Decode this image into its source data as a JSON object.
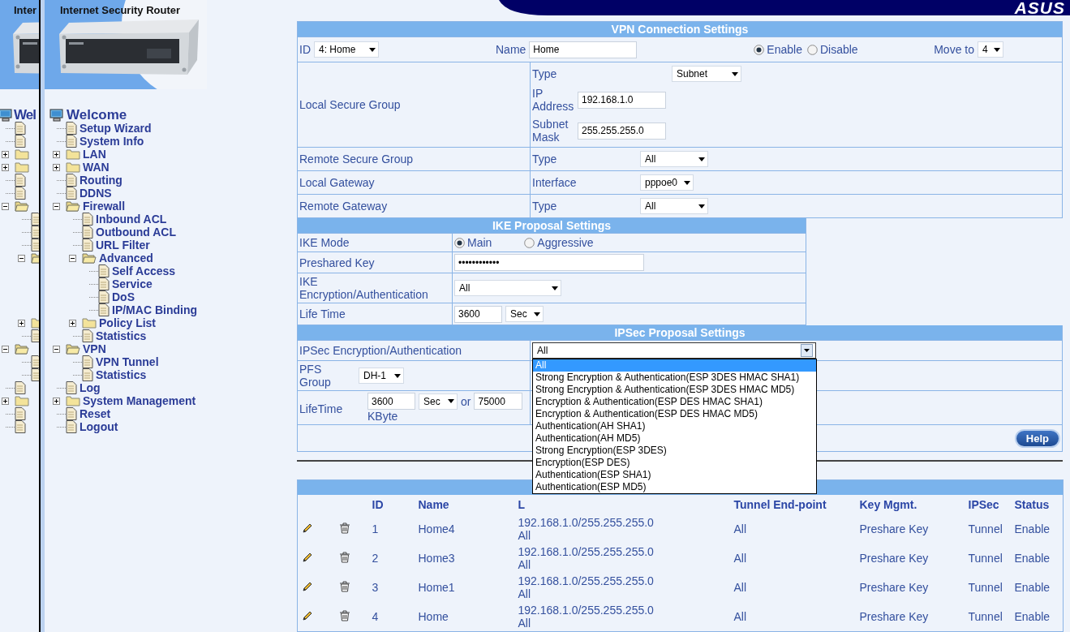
{
  "header": {
    "logo": "ASUS"
  },
  "ghost_sidebar": {
    "banner_title": "Inter",
    "root_label": "Wel"
  },
  "sidebar": {
    "banner_title": "Internet Security Router",
    "tree": [
      {
        "kind": "computer",
        "label": "Welcome",
        "children": [
          {
            "kind": "page",
            "label": "Setup Wizard"
          },
          {
            "kind": "page",
            "label": "System Info"
          },
          {
            "kind": "folder",
            "label": "LAN",
            "expanded": false
          },
          {
            "kind": "folder",
            "label": "WAN",
            "expanded": false
          },
          {
            "kind": "page",
            "label": "Routing"
          },
          {
            "kind": "page",
            "label": "DDNS"
          },
          {
            "kind": "folder",
            "label": "Firewall",
            "expanded": true,
            "children": [
              {
                "kind": "page",
                "label": "Inbound ACL"
              },
              {
                "kind": "page",
                "label": "Outbound ACL"
              },
              {
                "kind": "page",
                "label": "URL Filter"
              },
              {
                "kind": "folder",
                "label": "Advanced",
                "expanded": true,
                "children": [
                  {
                    "kind": "page",
                    "label": "Self Access"
                  },
                  {
                    "kind": "page",
                    "label": "Service"
                  },
                  {
                    "kind": "page",
                    "label": "DoS"
                  },
                  {
                    "kind": "page",
                    "label": "IP/MAC Binding"
                  }
                ]
              },
              {
                "kind": "folder",
                "label": "Policy List",
                "expanded": false
              },
              {
                "kind": "page",
                "label": "Statistics"
              }
            ]
          },
          {
            "kind": "folder",
            "label": "VPN",
            "expanded": true,
            "children": [
              {
                "kind": "page",
                "label": "VPN Tunnel"
              },
              {
                "kind": "page",
                "label": "Statistics"
              }
            ]
          },
          {
            "kind": "page",
            "label": "Log"
          },
          {
            "kind": "folder",
            "label": "System Management",
            "expanded": false
          },
          {
            "kind": "page",
            "label": "Reset"
          },
          {
            "kind": "page",
            "label": "Logout"
          }
        ]
      }
    ]
  },
  "vpn_connection": {
    "title": "VPN Connection Settings",
    "id": {
      "label": "ID",
      "value": "4: Home"
    },
    "name": {
      "label": "Name",
      "value": "Home"
    },
    "status": [
      {
        "label": "Enable",
        "selected": true
      },
      {
        "label": "Disable",
        "selected": false
      }
    ],
    "move_to": {
      "label": "Move to",
      "value": "4"
    },
    "rows": [
      {
        "label": "Local Secure Group",
        "fields": [
          {
            "label": "Type",
            "kind": "select",
            "value": "Subnet"
          },
          {
            "label": "IP Address",
            "kind": "input",
            "value": "192.168.1.0"
          },
          {
            "label": "Subnet Mask",
            "kind": "input",
            "value": "255.255.255.0"
          }
        ]
      },
      {
        "label": "Remote Secure Group",
        "fields": [
          {
            "label": "Type",
            "kind": "select",
            "value": "All"
          }
        ]
      },
      {
        "label": "Local Gateway",
        "fields": [
          {
            "label": "Interface",
            "kind": "select",
            "value": "pppoe0"
          }
        ]
      },
      {
        "label": "Remote Gateway",
        "fields": [
          {
            "label": "Type",
            "kind": "select",
            "value": "All"
          }
        ]
      }
    ]
  },
  "ike_proposal": {
    "title": "IKE Proposal Settings",
    "mode": {
      "label": "IKE Mode",
      "options": [
        {
          "label": "Main",
          "selected": true
        },
        {
          "label": "Aggressive",
          "selected": false
        }
      ]
    },
    "preshared_key": {
      "label": "Preshared Key",
      "value": "••••••••••••"
    },
    "encryption": {
      "label": "IKE Encryption/Authentication",
      "value": "All"
    },
    "life_time": {
      "label": "Life Time",
      "value": "3600",
      "unit": "Sec"
    }
  },
  "ipsec_proposal": {
    "title": "IPSec Proposal Settings",
    "encryption": {
      "label": "IPSec Encryption/Authentication",
      "value": "All",
      "expanded": true,
      "options": [
        {
          "label": "All",
          "selected": true
        },
        {
          "label": "Strong Encryption & Authentication(ESP 3DES HMAC SHA1)",
          "selected": false
        },
        {
          "label": "Strong Encryption & Authentication(ESP 3DES HMAC MD5)",
          "selected": false
        },
        {
          "label": "Encryption & Authentication(ESP DES HMAC SHA1)",
          "selected": false
        },
        {
          "label": "Encryption & Authentication(ESP DES HMAC MD5)",
          "selected": false
        },
        {
          "label": "Authentication(AH SHA1)",
          "selected": false
        },
        {
          "label": "Authentication(AH MD5)",
          "selected": false
        },
        {
          "label": "Strong Encryption(ESP 3DES)",
          "selected": false
        },
        {
          "label": "Encryption(ESP DES)",
          "selected": false
        },
        {
          "label": "Authentication(ESP SHA1)",
          "selected": false
        },
        {
          "label": "Authentication(ESP MD5)",
          "selected": false
        }
      ]
    },
    "pfs": {
      "label": "PFS Group",
      "value": "DH-1"
    },
    "lifetime": {
      "label": "LifeTime",
      "time": "3600",
      "unit": "Sec",
      "or": "or",
      "kbytes": "75000",
      "kbyte_label": "KByte"
    },
    "help": "Help"
  },
  "tunnels": {
    "columns": [
      "ID",
      "Name",
      "L",
      "Tunnel End-point",
      "Key Mgmt.",
      "IPSec",
      "Status"
    ],
    "rows": [
      {
        "id": "1",
        "name": "Home4",
        "local": "192.168.1.0/255.255.255.0",
        "remote": "All",
        "endpoint": "All",
        "key": "Preshare Key",
        "ipsec": "Tunnel",
        "status": "Enable"
      },
      {
        "id": "2",
        "name": "Home3",
        "local": "192.168.1.0/255.255.255.0",
        "remote": "All",
        "endpoint": "All",
        "key": "Preshare Key",
        "ipsec": "Tunnel",
        "status": "Enable"
      },
      {
        "id": "3",
        "name": "Home1",
        "local": "192.168.1.0/255.255.255.0",
        "remote": "All",
        "endpoint": "All",
        "key": "Preshare Key",
        "ipsec": "Tunnel",
        "status": "Enable"
      },
      {
        "id": "4",
        "name": "Home",
        "local": "192.168.1.0/255.255.255.0",
        "remote": "All",
        "endpoint": "All",
        "key": "Preshare Key",
        "ipsec": "Tunnel",
        "status": "Enable"
      }
    ]
  }
}
